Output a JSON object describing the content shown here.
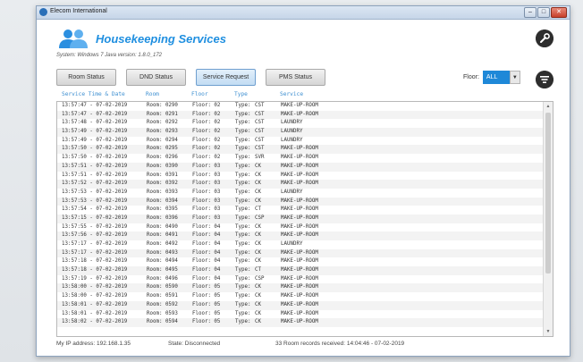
{
  "window": {
    "title": "Elecom International"
  },
  "header": {
    "app_title": "Housekeeping Services",
    "system_info": "System: Windows 7 Java version: 1.8.0_172"
  },
  "toolbar": {
    "buttons": [
      "Room Status",
      "DND Status",
      "Service Request",
      "PMS Status"
    ],
    "active_index": 2,
    "floor_label": "Floor:",
    "floor_value": "ALL"
  },
  "columns": [
    "Service Time & Date",
    "Room",
    "Floor",
    "Type",
    "Service"
  ],
  "rows": [
    {
      "time": "13:57:47 - 07-02-2019",
      "room": "Room: 0290",
      "floor": "Floor: 02",
      "type_label": "Type:",
      "type": "CST",
      "service": "MAKE-UP-ROOM"
    },
    {
      "time": "13:57:47 - 07-02-2019",
      "room": "Room: 0291",
      "floor": "Floor: 02",
      "type_label": "Type:",
      "type": "CST",
      "service": "MAKE-UP-ROOM"
    },
    {
      "time": "13:57:48 - 07-02-2019",
      "room": "Room: 0292",
      "floor": "Floor: 02",
      "type_label": "Type:",
      "type": "CST",
      "service": "LAUNDRY"
    },
    {
      "time": "13:57:49 - 07-02-2019",
      "room": "Room: 0293",
      "floor": "Floor: 02",
      "type_label": "Type:",
      "type": "CST",
      "service": "LAUNDRY"
    },
    {
      "time": "13:57:49 - 07-02-2019",
      "room": "Room: 0294",
      "floor": "Floor: 02",
      "type_label": "Type:",
      "type": "CST",
      "service": "LAUNDRY"
    },
    {
      "time": "13:57:50 - 07-02-2019",
      "room": "Room: 0295",
      "floor": "Floor: 02",
      "type_label": "Type:",
      "type": "CST",
      "service": "MAKE-UP-ROOM"
    },
    {
      "time": "13:57:50 - 07-02-2019",
      "room": "Room: 0296",
      "floor": "Floor: 02",
      "type_label": "Type:",
      "type": "SVR",
      "service": "MAKE-UP-ROOM"
    },
    {
      "time": "13:57:51 - 07-02-2019",
      "room": "Room: 0390",
      "floor": "Floor: 03",
      "type_label": "Type:",
      "type": "CK",
      "service": "MAKE-UP-ROOM"
    },
    {
      "time": "13:57:51 - 07-02-2019",
      "room": "Room: 0391",
      "floor": "Floor: 03",
      "type_label": "Type:",
      "type": "CK",
      "service": "MAKE-UP-ROOM"
    },
    {
      "time": "13:57:52 - 07-02-2019",
      "room": "Room: 0392",
      "floor": "Floor: 03",
      "type_label": "Type:",
      "type": "CK",
      "service": "MAKE-UP-ROOM"
    },
    {
      "time": "13:57:53 - 07-02-2019",
      "room": "Room: 0393",
      "floor": "Floor: 03",
      "type_label": "Type:",
      "type": "CK",
      "service": "LAUNDRY"
    },
    {
      "time": "13:57:53 - 07-02-2019",
      "room": "Room: 0394",
      "floor": "Floor: 03",
      "type_label": "Type:",
      "type": "CK",
      "service": "MAKE-UP-ROOM"
    },
    {
      "time": "13:57:54 - 07-02-2019",
      "room": "Room: 0395",
      "floor": "Floor: 03",
      "type_label": "Type:",
      "type": "CT",
      "service": "MAKE-UP-ROOM"
    },
    {
      "time": "13:57:15 - 07-02-2019",
      "room": "Room: 0396",
      "floor": "Floor: 03",
      "type_label": "Type:",
      "type": "CSP",
      "service": "MAKE-UP-ROOM"
    },
    {
      "time": "13:57:55 - 07-02-2019",
      "room": "Room: 0490",
      "floor": "Floor: 04",
      "type_label": "Type:",
      "type": "CK",
      "service": "MAKE-UP-ROOM"
    },
    {
      "time": "13:57:56 - 07-02-2019",
      "room": "Room: 0491",
      "floor": "Floor: 04",
      "type_label": "Type:",
      "type": "CK",
      "service": "MAKE-UP-ROOM"
    },
    {
      "time": "13:57:17 - 07-02-2019",
      "room": "Room: 0492",
      "floor": "Floor: 04",
      "type_label": "Type:",
      "type": "CK",
      "service": "LAUNDRY"
    },
    {
      "time": "13:57:17 - 07-02-2019",
      "room": "Room: 0493",
      "floor": "Floor: 04",
      "type_label": "Type:",
      "type": "CK",
      "service": "MAKE-UP-ROOM"
    },
    {
      "time": "13:57:18 - 07-02-2019",
      "room": "Room: 0494",
      "floor": "Floor: 04",
      "type_label": "Type:",
      "type": "CK",
      "service": "MAKE-UP-ROOM"
    },
    {
      "time": "13:57:18 - 07-02-2019",
      "room": "Room: 0495",
      "floor": "Floor: 04",
      "type_label": "Type:",
      "type": "CT",
      "service": "MAKE-UP-ROOM"
    },
    {
      "time": "13:57:19 - 07-02-2019",
      "room": "Room: 0496",
      "floor": "Floor: 04",
      "type_label": "Type:",
      "type": "CSP",
      "service": "MAKE-UP-ROOM"
    },
    {
      "time": "13:58:00 - 07-02-2019",
      "room": "Room: 0590",
      "floor": "Floor: 05",
      "type_label": "Type:",
      "type": "CK",
      "service": "MAKE-UP-ROOM"
    },
    {
      "time": "13:58:00 - 07-02-2019",
      "room": "Room: 0591",
      "floor": "Floor: 05",
      "type_label": "Type:",
      "type": "CK",
      "service": "MAKE-UP-ROOM"
    },
    {
      "time": "13:58:01 - 07-02-2019",
      "room": "Room: 0592",
      "floor": "Floor: 05",
      "type_label": "Type:",
      "type": "CK",
      "service": "MAKE-UP-ROOM"
    },
    {
      "time": "13:58:01 - 07-02-2019",
      "room": "Room: 0593",
      "floor": "Floor: 05",
      "type_label": "Type:",
      "type": "CK",
      "service": "MAKE-UP-ROOM"
    },
    {
      "time": "13:58:02 - 07-02-2019",
      "room": "Room: 0594",
      "floor": "Floor: 05",
      "type_label": "Type:",
      "type": "CK",
      "service": "MAKE-UP-ROOM"
    }
  ],
  "status": {
    "ip": "My IP address: 192.168.1.35",
    "state": "State: Disconnected",
    "records": "33 Room records received: 14:04:46 - 07-02-2019"
  },
  "colors": {
    "accent": "#1e88d8",
    "title": "#1f8fe0",
    "column_header": "#3d8fd1"
  },
  "icons": [
    "people-icon",
    "wrench-icon",
    "filter-icon",
    "minimize-icon",
    "maximize-icon",
    "close-icon"
  ]
}
